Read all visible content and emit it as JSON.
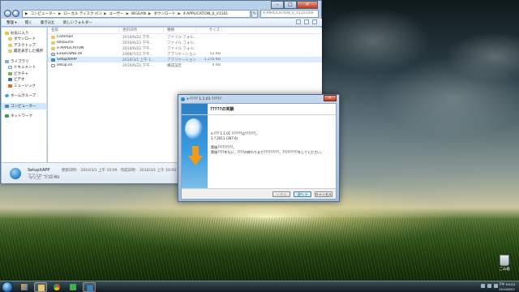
{
  "desktop": {
    "recycle_bin_label": "ごみ箱"
  },
  "explorer": {
    "address_crumbs": [
      "コンピューター",
      "ローカル ディスク (C:)",
      "ユーザー",
      "BIGGAN",
      "ダウンロード",
      "4-APPLICATION_0_V1101"
    ],
    "search_placeholder": "4-APPLICATION_0_V1101の検索",
    "toolbar": {
      "organize": "整理 ▾",
      "open": "開く",
      "burn": "書き込む",
      "new_folder": "新しいフォルダー"
    },
    "nav": [
      {
        "label": "お気に入り",
        "icon": "star-icon",
        "sub": false
      },
      {
        "label": "ダウンロード",
        "icon": "folder-icon",
        "sub": true
      },
      {
        "label": "デスクトップ",
        "icon": "folder-icon",
        "sub": true
      },
      {
        "label": "最近表示した場所",
        "icon": "folder-icon",
        "sub": true
      },
      {
        "label": "ライブラリ",
        "icon": "library-icon",
        "sub": false
      },
      {
        "label": "ドキュメント",
        "icon": "document-icon",
        "sub": true
      },
      {
        "label": "ピクチャ",
        "icon": "picture-icon",
        "sub": true
      },
      {
        "label": "ビデオ",
        "icon": "video-icon",
        "sub": true
      },
      {
        "label": "ミュージック",
        "icon": "music-icon",
        "sub": true
      },
      {
        "label": "ホームグループ",
        "icon": "homegroup-icon",
        "sub": false
      },
      {
        "label": "コンピューター",
        "icon": "computer-icon",
        "sub": false
      },
      {
        "label": "ネットワーク",
        "icon": "network-icon",
        "sub": false
      }
    ],
    "columns": {
      "name": "名前",
      "date": "更新日時",
      "type": "種類",
      "size": "サイズ"
    },
    "files": [
      {
        "name": "Common",
        "date": "2010/6/22 下午...",
        "type": "ファイル フォル...",
        "size": "",
        "kind": "folder"
      },
      {
        "name": "Resource",
        "date": "2010/6/22 下午...",
        "type": "ファイル フォル...",
        "size": "",
        "kind": "folder"
      },
      {
        "name": "x-APPLICATION",
        "date": "2010/6/22 下午...",
        "type": "ファイル フォル...",
        "size": "",
        "kind": "folder"
      },
      {
        "name": "ExSerialNo.dll",
        "date": "2008/7/15 下午...",
        "type": "アプリケーション...",
        "size": "52 KB",
        "kind": "dll"
      },
      {
        "name": "SetupXAPP",
        "date": "2010/3/1 上午 1...",
        "type": "アプリケーション",
        "size": "1,370 KB",
        "kind": "app"
      },
      {
        "name": "setup.ini",
        "date": "2010/6/22 下午...",
        "type": "構成設定",
        "size": "4 KB",
        "kind": "ini"
      }
    ],
    "details": {
      "name": "SetupXAPP",
      "kind": "アプリケーション",
      "modified_label": "更新日時:",
      "modified": "2010/3/1 上午 10:09",
      "created_label": "作成日時:",
      "created": "2010/3/1 上午 10:09",
      "size_label": "サイズ:",
      "size": "1.33 MB"
    }
  },
  "installer": {
    "title": "x-???? 1.1.01 ?????",
    "header": "?????の実験",
    "lines": [
      "x-??? 1.1.01 ??????は??????。",
      "1 ?          2011 (307.6)"
    ],
    "lines2": [
      "実施?????????。",
      "実施????を行い、????の終わりまで?????????、?????????をしてください。"
    ],
    "btn_back": "< 戻る",
    "btn_next": "次へ >",
    "btn_cancel": "キャンセル"
  },
  "taskbar": {
    "clock_time": "下午 04:24",
    "clock_date": "2010/6/22"
  }
}
